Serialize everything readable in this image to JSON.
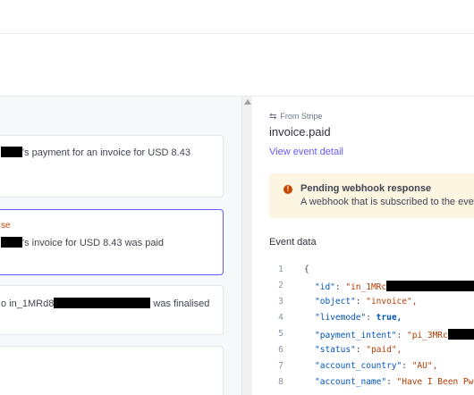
{
  "events_list": {
    "items": [
      {
        "text": "'s payment for an invoice for USD 8.43"
      },
      {
        "status": "se",
        "text": "'s invoice for USD 8.43 was paid"
      },
      {
        "text_before": "o in_1MRd8",
        "text_after": " was finalised"
      },
      {
        "text": ""
      }
    ]
  },
  "detail": {
    "source": "From Stripe",
    "event_type": "invoice.paid",
    "view_link": "View event detail",
    "banner": {
      "title": "Pending webhook response",
      "body": "A webhook that is subscribed to the eve"
    },
    "section_label": "Event data",
    "code_lines": [
      {
        "n": "1",
        "brace": "{"
      },
      {
        "n": "2",
        "key": "\"id\"",
        "value": "\"in_1MRc"
      },
      {
        "n": "3",
        "key": "\"object\"",
        "value": "\"invoice\","
      },
      {
        "n": "4",
        "key": "\"livemode\"",
        "value": "true,"
      },
      {
        "n": "5",
        "key": "\"payment_intent\"",
        "value": "\"pi_3MRc"
      },
      {
        "n": "6",
        "key": "\"status\"",
        "value": "\"paid\","
      },
      {
        "n": "7",
        "key": "\"account_country\"",
        "value": "\"AU\","
      },
      {
        "n": "8",
        "key": "\"account_name\"",
        "value": "\"Have I Been Pwn"
      }
    ]
  }
}
